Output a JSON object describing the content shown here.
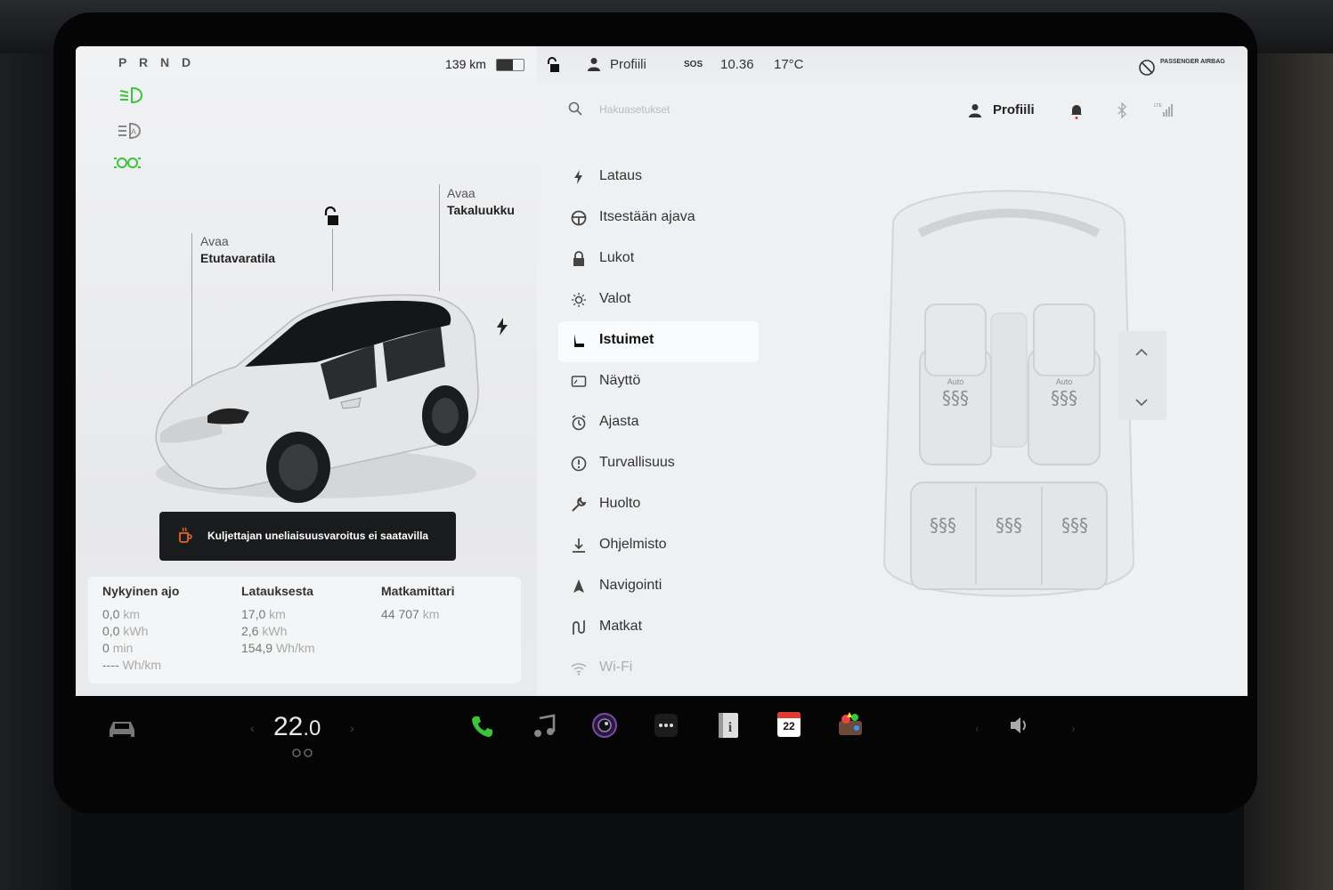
{
  "status": {
    "gears": "P R N D",
    "range": "139 km",
    "profile": "Profiili",
    "sos": "SOS",
    "time": "10.36",
    "outside_temp": "17°C",
    "airbag": "PASSENGER AIRBAG"
  },
  "car_view": {
    "frunk_action": "Avaa",
    "frunk_label": "Etutavaratila",
    "trunk_action": "Avaa",
    "trunk_label": "Takaluukku"
  },
  "alert": {
    "text": "Kuljettajan uneliaisuusvaroitus ei saatavilla"
  },
  "trip": {
    "current": {
      "title": "Nykyinen ajo",
      "rows": [
        {
          "v": "0,0",
          "u": "km"
        },
        {
          "v": "0,0",
          "u": "kWh"
        },
        {
          "v": "0",
          "u": "min"
        },
        {
          "v": "----",
          "u": "Wh/km"
        }
      ]
    },
    "since_charge": {
      "title": "Latauksesta",
      "rows": [
        {
          "v": "17,0",
          "u": "km"
        },
        {
          "v": "2,6",
          "u": "kWh"
        },
        {
          "v": "154,9",
          "u": "Wh/km"
        }
      ]
    },
    "odometer": {
      "title": "Matkamittari",
      "rows": [
        {
          "v": "44 707",
          "u": "km"
        }
      ]
    }
  },
  "search": {
    "placeholder": "Hakuasetukset",
    "profile": "Profiili"
  },
  "menu": [
    {
      "label": "Lataus",
      "icon": "bolt-icon"
    },
    {
      "label": "Itsestään ajava",
      "icon": "steering-wheel-icon"
    },
    {
      "label": "Lukot",
      "icon": "lock-icon"
    },
    {
      "label": "Valot",
      "icon": "light-icon"
    },
    {
      "label": "Istuimet",
      "icon": "seat-icon",
      "selected": true
    },
    {
      "label": "Näyttö",
      "icon": "display-icon"
    },
    {
      "label": "Ajasta",
      "icon": "schedule-icon"
    },
    {
      "label": "Turvallisuus",
      "icon": "safety-icon"
    },
    {
      "label": "Huolto",
      "icon": "wrench-icon"
    },
    {
      "label": "Ohjelmisto",
      "icon": "download-icon"
    },
    {
      "label": "Navigointi",
      "icon": "navigation-icon"
    },
    {
      "label": "Matkat",
      "icon": "trips-icon"
    },
    {
      "label": "Wi-Fi",
      "icon": "wifi-icon"
    }
  ],
  "seats": {
    "front_left": "Auto",
    "front_right": "Auto"
  },
  "dock": {
    "temp_whole": "22",
    "temp_decimal": ".0",
    "calendar_day": "22"
  },
  "colors": {
    "accent_green": "#3cc23c",
    "alert_bg": "#1a1b1d",
    "alert_icon": "#e8642a",
    "notification_dot": "#e0312b"
  }
}
